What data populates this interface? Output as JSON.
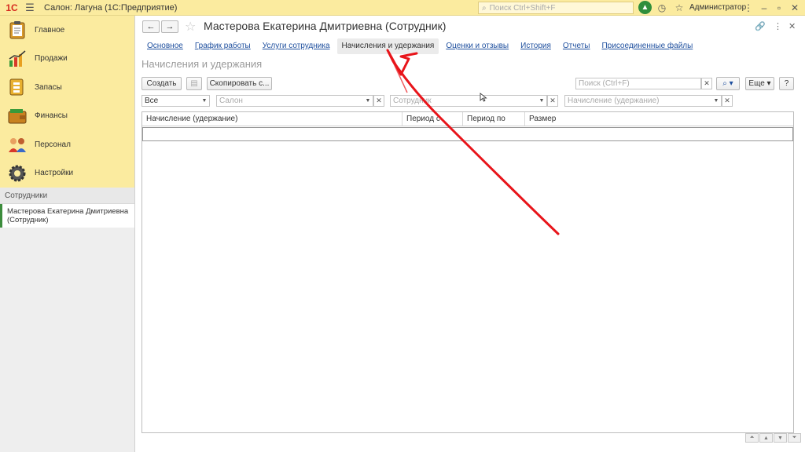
{
  "titlebar": {
    "logo": "1С",
    "app_title": "Салон: Лагуна  (1С:Предприятие)",
    "search_placeholder": "Поиск Ctrl+Shift+F",
    "user": "Администратор"
  },
  "sections": [
    {
      "label": "Главное",
      "icon": "clipboard-icon"
    },
    {
      "label": "Продажи",
      "icon": "chart-icon"
    },
    {
      "label": "Запасы",
      "icon": "box-icon"
    },
    {
      "label": "Финансы",
      "icon": "wallet-icon"
    },
    {
      "label": "Персонал",
      "icon": "people-icon"
    },
    {
      "label": "Настройки",
      "icon": "gear-icon"
    }
  ],
  "open_windows": {
    "title": "Сотрудники",
    "items": [
      "Мастерова Екатерина Дмитриевна (Сотрудник)"
    ]
  },
  "form": {
    "title": "Мастерова Екатерина Дмитриевна (Сотрудник)",
    "tabs": [
      {
        "label": "Основное",
        "active": false
      },
      {
        "label": "График работы",
        "active": false
      },
      {
        "label": "Услуги сотрудника",
        "active": false
      },
      {
        "label": "Начисления и удержания",
        "active": true
      },
      {
        "label": "Оценки и отзывы",
        "active": false
      },
      {
        "label": "История",
        "active": false
      },
      {
        "label": "Отчеты",
        "active": false
      },
      {
        "label": "Присоединенные файлы",
        "active": false
      }
    ],
    "section_title": "Начисления и удержания",
    "toolbar": {
      "create": "Создать",
      "copy": "Скопировать с...",
      "search_placeholder": "Поиск (Ctrl+F)",
      "more": "Еще",
      "help": "?"
    },
    "filters": {
      "period_value": "Все",
      "salon_placeholder": "Салон",
      "employee_placeholder": "Сотрудник",
      "accrual_placeholder": "Начисление (удержание)"
    },
    "table": {
      "columns": [
        "Начисление (удержание)",
        "Период с",
        "Период по",
        "Размер"
      ]
    }
  },
  "colors": {
    "panel_yellow": "#fbeb9f",
    "link_blue": "#1e4f9e",
    "annotation_red": "#e8141a"
  }
}
